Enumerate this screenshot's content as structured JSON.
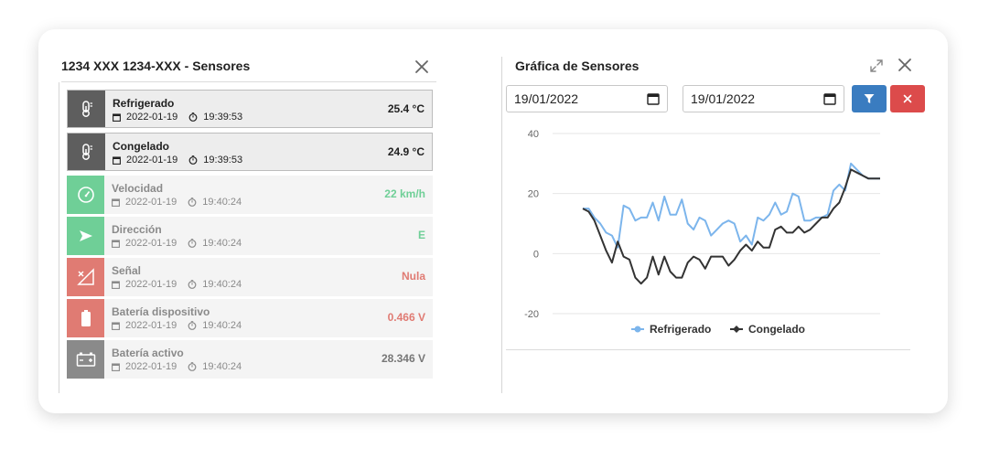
{
  "left_panel": {
    "title": "1234 XXX 1234-XXX - Sensores",
    "sensors": [
      {
        "name": "Refrigerado",
        "date": "2022-01-19",
        "time": "19:39:53",
        "value": "25.4 °C",
        "icon": "thermometer-icon",
        "icon_bg": "#5e5e5e",
        "value_color": "#222222"
      },
      {
        "name": "Congelado",
        "date": "2022-01-19",
        "time": "19:39:53",
        "value": "24.9 °C",
        "icon": "thermometer-icon",
        "icon_bg": "#5e5e5e",
        "value_color": "#222222"
      },
      {
        "name": "Velocidad",
        "date": "2022-01-19",
        "time": "19:40:24",
        "value": "22 km/h",
        "icon": "speedometer-icon",
        "icon_bg": "#6fcf97",
        "value_color": "#6fcf97"
      },
      {
        "name": "Dirección",
        "date": "2022-01-19",
        "time": "19:40:24",
        "value": "E",
        "icon": "direction-arrow-icon",
        "icon_bg": "#6fcf97",
        "value_color": "#6fcf97"
      },
      {
        "name": "Señal",
        "date": "2022-01-19",
        "time": "19:40:24",
        "value": "Nula",
        "icon": "no-signal-icon",
        "icon_bg": "#e07b73",
        "value_color": "#e07b73"
      },
      {
        "name": "Batería dispositivo",
        "date": "2022-01-19",
        "time": "19:40:24",
        "value": "0.466 V",
        "icon": "battery-icon",
        "icon_bg": "#e07b73",
        "value_color": "#e07b73"
      },
      {
        "name": "Batería activo",
        "date": "2022-01-19",
        "time": "19:40:24",
        "value": "28.346 V",
        "icon": "car-battery-icon",
        "icon_bg": "#8a8a8a",
        "value_color": "#777777"
      }
    ]
  },
  "right_panel": {
    "title": "Gráfica de Sensores",
    "date_from": "19/01/2022",
    "date_to": "19/01/2022"
  },
  "chart_data": {
    "type": "line",
    "ylim": [
      -20,
      40
    ],
    "yticks": [
      "40",
      "20",
      "0",
      "-20"
    ],
    "legend_position": "bottom",
    "series": [
      {
        "name": "Refrigerado",
        "color": "#7cb5ec",
        "values": [
          15,
          15,
          12,
          10,
          7,
          6,
          2,
          16,
          15,
          11,
          12,
          12,
          17,
          11,
          19,
          13,
          13,
          18,
          10,
          8,
          12,
          11,
          6,
          8,
          10,
          11,
          10,
          4,
          6,
          3,
          12,
          11,
          13,
          17,
          13,
          14,
          20,
          19,
          11,
          11,
          12,
          12,
          13,
          21,
          23,
          21,
          30,
          28,
          26,
          25,
          25,
          25
        ]
      },
      {
        "name": "Congelado",
        "color": "#333333",
        "values": [
          15,
          14,
          11,
          6,
          1,
          -3,
          4,
          -1,
          -2,
          -8,
          -10,
          -8,
          -1,
          -7,
          -1,
          -6,
          -8,
          -8,
          -3,
          -1,
          -2,
          -5,
          -1,
          -1,
          -1,
          -4,
          -2,
          1,
          3,
          1,
          4,
          2,
          2,
          8,
          9,
          7,
          7,
          9,
          7,
          8,
          10,
          12,
          12,
          15,
          17,
          22,
          28,
          27,
          26,
          25,
          25,
          25
        ]
      }
    ]
  }
}
